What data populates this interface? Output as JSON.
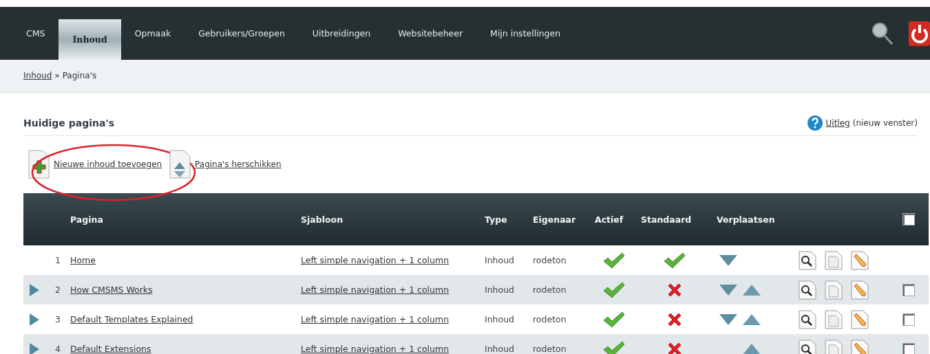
{
  "nav": {
    "tabs": [
      {
        "label": "CMS",
        "selected": false
      },
      {
        "label": "Inhoud",
        "selected": true
      },
      {
        "label": "Opmaak",
        "selected": false
      },
      {
        "label": "Gebruikers/Groepen",
        "selected": false
      },
      {
        "label": "Uitbreidingen",
        "selected": false
      },
      {
        "label": "Websitebeheer",
        "selected": false
      },
      {
        "label": "Mijn instellingen",
        "selected": false
      }
    ]
  },
  "breadcrumb": {
    "link": "Inhoud",
    "separator": "»",
    "current": "Pagina's"
  },
  "section": {
    "title": "Huidige pagina's",
    "help_link": "Uitleg",
    "help_note": "(nieuw venster)"
  },
  "actions": [
    {
      "label": "Nieuwe inhoud toevoegen",
      "kind": "add",
      "highlighted": true
    },
    {
      "label": "Pagina's herschikken",
      "kind": "reorder",
      "highlighted": false
    }
  ],
  "table": {
    "columns": [
      "Pagina",
      "Sjabloon",
      "Type",
      "Eigenaar",
      "Actief",
      "Standaard",
      "Verplaatsen"
    ],
    "select_all_checked": false,
    "rows": [
      {
        "expandable": false,
        "number": "1",
        "title": "Home",
        "template": "Left simple navigation + 1 column",
        "type": "Inhoud",
        "owner": "rodeton",
        "active": true,
        "default": true,
        "move_down": true,
        "move_up": false,
        "selectable": false
      },
      {
        "expandable": true,
        "number": "2",
        "title": "How CMSMS Works",
        "template": "Left simple navigation + 1 column",
        "type": "Inhoud",
        "owner": "rodeton",
        "active": true,
        "default": false,
        "move_down": true,
        "move_up": true,
        "selectable": true,
        "checked": false
      },
      {
        "expandable": true,
        "number": "3",
        "title": "Default Templates Explained",
        "template": "Left simple navigation + 1 column",
        "type": "Inhoud",
        "owner": "rodeton",
        "active": true,
        "default": false,
        "move_down": true,
        "move_up": true,
        "selectable": true,
        "checked": false
      },
      {
        "expandable": true,
        "number": "4",
        "title": "Default Extensions",
        "template": "Left simple navigation + 1 column",
        "type": "Inhoud",
        "owner": "rodeton",
        "active": true,
        "default": false,
        "move_down": false,
        "move_up": true,
        "selectable": true,
        "checked": false
      }
    ]
  }
}
